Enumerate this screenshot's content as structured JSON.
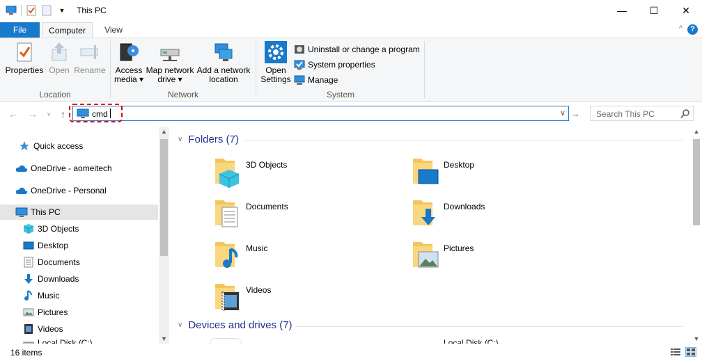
{
  "window": {
    "title": "This PC",
    "controls": [
      "minimize",
      "maximize",
      "close"
    ]
  },
  "tabs": {
    "file": "File",
    "computer": "Computer",
    "view": "View"
  },
  "ribbon": {
    "location": {
      "label": "Location",
      "properties": "Properties",
      "open": "Open",
      "rename": "Rename"
    },
    "network": {
      "label": "Network",
      "access_media_1": "Access",
      "access_media_2": "media ▾",
      "map_drive_1": "Map network",
      "map_drive_2": "drive ▾",
      "add_location_1": "Add a network",
      "add_location_2": "location"
    },
    "system": {
      "label": "System",
      "open_settings_1": "Open",
      "open_settings_2": "Settings",
      "uninstall": "Uninstall or change a program",
      "system_properties": "System properties",
      "manage": "Manage"
    }
  },
  "address": {
    "value": "cmd",
    "search_placeholder": "Search This PC"
  },
  "sidebar": {
    "items": [
      {
        "label": "Quick access",
        "icon": "star-icon"
      },
      {
        "label": "OneDrive - aomeitech",
        "icon": "cloud-icon"
      },
      {
        "label": "OneDrive - Personal",
        "icon": "cloud-icon"
      },
      {
        "label": "This PC",
        "icon": "pc-icon",
        "selected": true
      },
      {
        "label": "3D Objects",
        "icon": "cube-icon"
      },
      {
        "label": "Desktop",
        "icon": "desktop-icon"
      },
      {
        "label": "Documents",
        "icon": "document-icon"
      },
      {
        "label": "Downloads",
        "icon": "download-icon"
      },
      {
        "label": "Music",
        "icon": "music-icon"
      },
      {
        "label": "Pictures",
        "icon": "picture-icon"
      },
      {
        "label": "Videos",
        "icon": "video-icon"
      },
      {
        "label": "Local Disk (C:)",
        "icon": "disk-icon"
      }
    ]
  },
  "main": {
    "folders_header": "Folders (7)",
    "drives_header": "Devices and drives (7)",
    "folders": [
      {
        "label": "3D Objects",
        "icon": "cube-folder-icon"
      },
      {
        "label": "Desktop",
        "icon": "desktop-folder-icon"
      },
      {
        "label": "Documents",
        "icon": "documents-folder-icon"
      },
      {
        "label": "Downloads",
        "icon": "downloads-folder-icon"
      },
      {
        "label": "Music",
        "icon": "music-folder-icon"
      },
      {
        "label": "Pictures",
        "icon": "pictures-folder-icon"
      },
      {
        "label": "Videos",
        "icon": "videos-folder-icon"
      }
    ],
    "drive_partial": "Local Disk (C:)"
  },
  "status": {
    "items": "16 items"
  },
  "colors": {
    "accent": "#1979ca",
    "highlight": "#e00000",
    "header_text": "#1e3287",
    "folder": "#f4c55a"
  }
}
